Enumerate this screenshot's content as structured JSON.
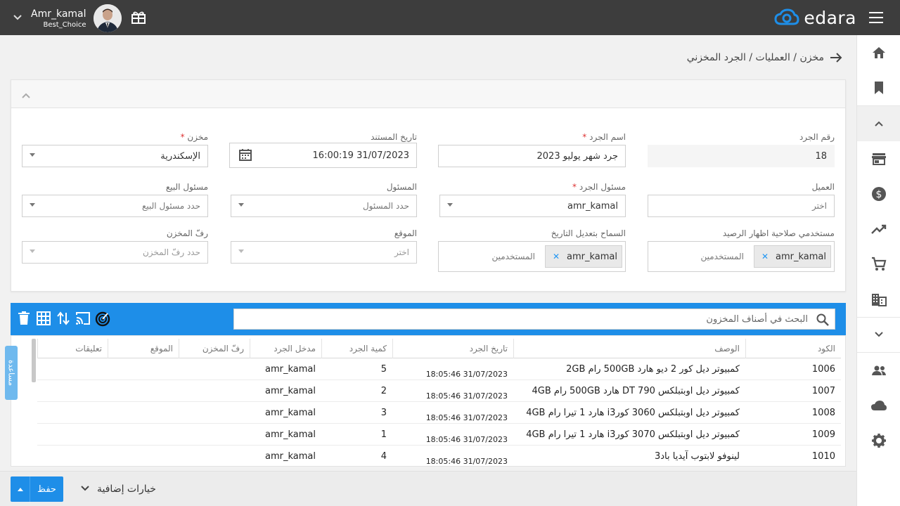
{
  "header": {
    "brand": "edara",
    "user_name": "Amr_kamal",
    "user_company": "Best_Choice"
  },
  "breadcrumb": "مخزن / العمليات / الجرد المخزني",
  "form": {
    "inventory_number": {
      "label": "رقم الجرد",
      "value": "18"
    },
    "inventory_name": {
      "label": "اسم الجرد",
      "required": "*",
      "value": "جرد شهر يوليو 2023"
    },
    "document_date": {
      "label": "تاريخ المستند",
      "value": "31/07/2023 16:00:19"
    },
    "warehouse": {
      "label": "مخزن",
      "required": "*",
      "value": "الإسكندرية"
    },
    "customer": {
      "label": "العميل",
      "placeholder": "اختر"
    },
    "inventory_responsible": {
      "label": "مسئول الجرد",
      "required": "*",
      "value": "amr_kamal"
    },
    "responsible": {
      "label": "المسئول",
      "placeholder": "حدد المسئول"
    },
    "sales_responsible": {
      "label": "مسئول البيع",
      "placeholder": "حدد مسئول البيع"
    },
    "balance_users": {
      "label": "مستخدمي صلاحية اظهار الرصيد",
      "chip": "amr_kamal",
      "placeholder": "المستخدمين"
    },
    "date_edit_users": {
      "label": "السماح بتعديل التاريخ",
      "chip": "amr_kamal",
      "placeholder": "المستخدمين"
    },
    "location": {
      "label": "الموقع",
      "placeholder": "اختر"
    },
    "shelf": {
      "label": "رفّ المخزن",
      "placeholder": "حدد رفّ المخزن"
    }
  },
  "toolbar": {
    "search_placeholder": "البحث في أصناف المخزون"
  },
  "table": {
    "headers": {
      "code": "الكود",
      "description": "الوصف",
      "date": "تاريخ الجرد",
      "qty": "كمية الجرد",
      "entry": "مدخل الجرد",
      "shelf": "رفّ المخزن",
      "location": "الموقع",
      "comments": "تعليقات"
    },
    "rows": [
      {
        "code": "1006",
        "description": "كمبيوتر ديل كور 2 ديو هارد 500GB رام 2GB",
        "date": "31/07/2023 18:05:46",
        "qty": "5",
        "entry": "amr_kamal"
      },
      {
        "code": "1007",
        "description": "كمبيوتر ديل اوبتبلكس DT 790 هارد 500GB رام 4GB",
        "date": "31/07/2023 18:05:46",
        "qty": "2",
        "entry": "amr_kamal"
      },
      {
        "code": "1008",
        "description": "كمبيوتر ديل اوبتبلكس 3060 كورi3 هارد 1 تيرا رام 4GB",
        "date": "31/07/2023 18:05:46",
        "qty": "3",
        "entry": "amr_kamal"
      },
      {
        "code": "1009",
        "description": "كمبيوتر ديل اوبتبلكس 3070 كورi3 هارد 1 تيرا رام 4GB",
        "date": "31/07/2023 18:05:46",
        "qty": "1",
        "entry": "amr_kamal"
      },
      {
        "code": "1010",
        "description": "لينوفو لابتوب آيديا باد3",
        "date": "31/07/2023 18:05:46",
        "qty": "4",
        "entry": "amr_kamal"
      }
    ]
  },
  "help_tab": "مساعدة",
  "footer": {
    "save_label": "حفظ",
    "more_options": "خيارات إضافية"
  },
  "colors": {
    "accent": "#1e8ee8",
    "topbar": "#3d3d3d"
  },
  "sidebar_icons": [
    "home-icon",
    "bookmark-icon",
    "chevron-up-icon",
    "store-icon",
    "dollar-icon",
    "trending-icon",
    "cart-icon",
    "building-icon",
    "chevron-down-icon",
    "users-icon",
    "cloud-icon",
    "settings-icon"
  ]
}
